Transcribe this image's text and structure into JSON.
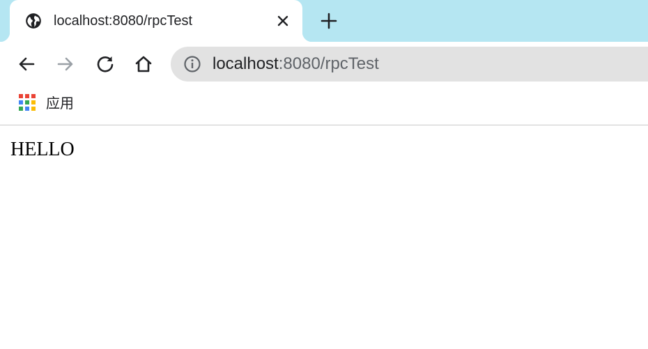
{
  "tab": {
    "title": "localhost:8080/rpcTest",
    "favicon_icon": "globe-icon",
    "close_icon": "close-icon"
  },
  "new_tab_icon": "plus-icon",
  "toolbar": {
    "back_icon": "arrow-left-icon",
    "forward_icon": "arrow-right-icon",
    "reload_icon": "reload-icon",
    "home_icon": "home-icon"
  },
  "omnibox": {
    "info_icon": "info-icon",
    "url_host": "localhost",
    "url_rest": ":8080/rpcTest"
  },
  "bookmarks": {
    "apps_label": "应用",
    "apps_icon": "apps-grid-icon"
  },
  "page": {
    "body_text": "HELLO"
  },
  "colors": {
    "tabstrip": "#b5e6f2",
    "omnibox": "#e2e2e2",
    "forward_disabled": "#9aa0a6"
  }
}
